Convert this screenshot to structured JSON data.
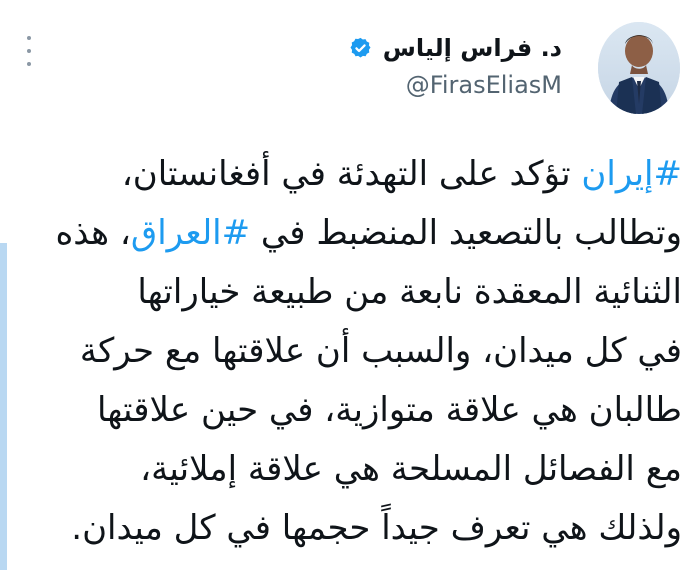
{
  "colors": {
    "accent": "#1d9bf0",
    "text": "#0f1419",
    "muted": "#536471",
    "left_accent": "#b9d8f2"
  },
  "icons": {
    "more": "more-vertical-icon",
    "verified": "verified-badge-icon"
  },
  "profile": {
    "name": "د. فراس إلياس",
    "handle": "@FirasEliasM"
  },
  "tweet": {
    "line1_hashtag": "#إيران",
    "line1_text": " تؤكد على التهدئة في أفغانستان،",
    "line2_start": "وتطالب بالتصعيد المنضبط في ",
    "line2_hashtag": "#العراق",
    "line2_end": "، هذه",
    "line3": "الثنائية المعقدة نابعة من طبيعة خياراتها",
    "line4": "في كل ميدان، والسبب أن علاقتها مع حركة",
    "line5": "طالبان هي علاقة متوازية، في حين علاقتها",
    "line6": "مع الفصائل المسلحة هي علاقة إملائية،",
    "line7": "ولذلك هي تعرف جيداً حجمها في كل ميدان."
  }
}
